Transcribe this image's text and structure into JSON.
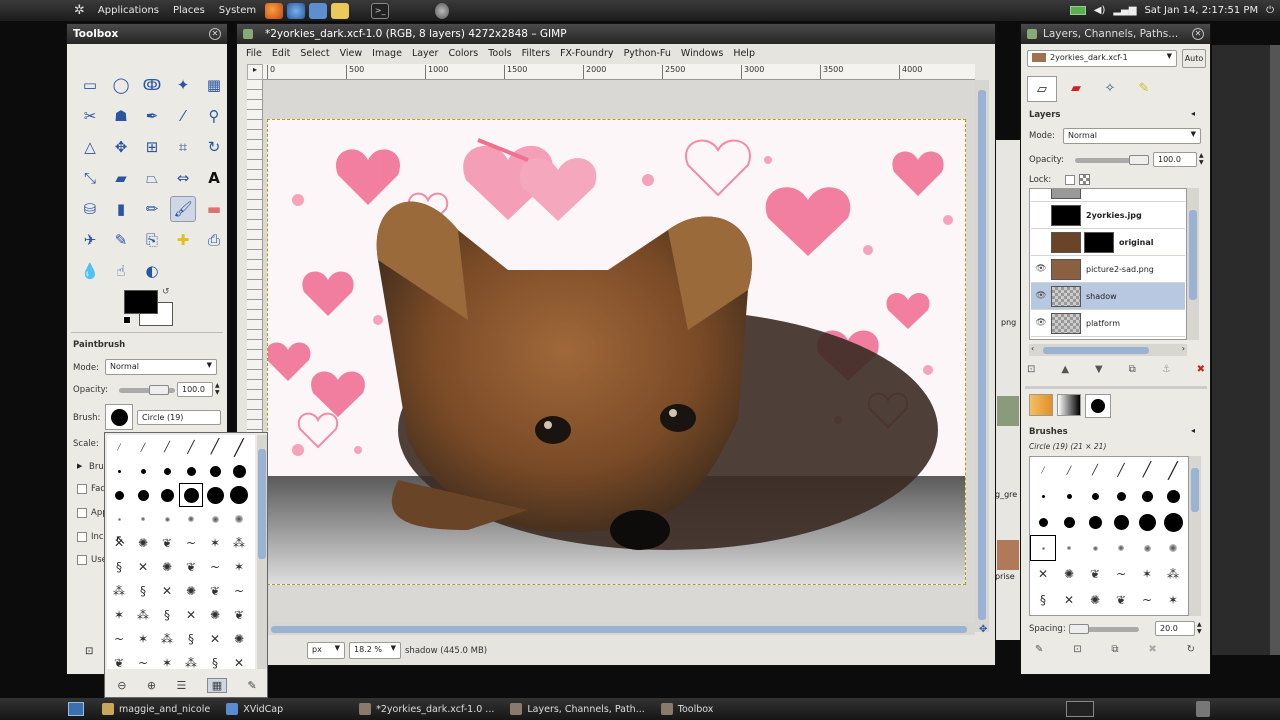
{
  "top_panel": {
    "menus": [
      "Applications",
      "Places",
      "System"
    ],
    "datetime": "Sat Jan 14,  2:17:51 PM"
  },
  "toolbox": {
    "title": "Toolbox",
    "tool_icons": [
      "rect-select-icon",
      "ellipse-select-icon",
      "free-select-icon",
      "fuzzy-select-icon",
      "color-select-icon",
      "scissors-icon",
      "foreground-select-icon",
      "paths-icon",
      "color-picker-icon",
      "zoom-icon",
      "measure-icon",
      "move-icon",
      "align-icon",
      "crop-icon",
      "rotate-icon",
      "scale-icon",
      "shear-icon",
      "perspective-icon",
      "flip-icon",
      "text-icon",
      "bucket-fill-icon",
      "blend-icon",
      "pencil-icon",
      "paintbrush-icon",
      "eraser-icon",
      "airbrush-icon",
      "ink-icon",
      "clone-icon",
      "heal-icon",
      "perspective-clone-icon",
      "blur-icon",
      "smudge-icon",
      "dodge-burn-icon"
    ],
    "selected_tool": 23,
    "options": {
      "title": "Paintbrush",
      "mode_label": "Mode:",
      "mode_value": "Normal",
      "opacity_label": "Opacity:",
      "opacity_value": "100.0",
      "brush_label": "Brush:",
      "brush_value": "Circle (19)",
      "scale_label": "Scale:",
      "brush_dynamics": "Bru",
      "cut_labels": [
        "Fad",
        "App",
        "Inc",
        "Use"
      ]
    }
  },
  "image_window": {
    "title": "*2yorkies_dark.xcf-1.0 (RGB, 8 layers) 4272x2848 – GIMP",
    "menu": [
      "File",
      "Edit",
      "Select",
      "View",
      "Image",
      "Layer",
      "Colors",
      "Tools",
      "Filters",
      "FX-Foundry",
      "Python-Fu",
      "Windows",
      "Help"
    ],
    "ruler_ticks": [
      "0",
      "500",
      "1000",
      "1500",
      "2000",
      "2500",
      "3000",
      "3500",
      "4000"
    ],
    "unit": "px",
    "zoom": "18.2 %",
    "status": "shadow (445.0 MB)"
  },
  "dock": {
    "title": "Layers, Channels, Paths...",
    "image_select": "2yorkies_dark.xcf-1",
    "auto_label": "Auto",
    "layers_tab_title": "Layers",
    "mode_label": "Mode:",
    "mode_value": "Normal",
    "opacity_label": "Opacity:",
    "opacity_value": "100.0",
    "lock_label": "Lock:",
    "layers": [
      {
        "name": "2yorkies.jpg",
        "visible": false,
        "mask": true,
        "bold": true
      },
      {
        "name": "original",
        "visible": false,
        "mask": true,
        "bold": true
      },
      {
        "name": "picture2-sad.png",
        "visible": true,
        "mask": false,
        "bold": false
      },
      {
        "name": "shadow",
        "visible": true,
        "mask": false,
        "bold": false,
        "selected": true
      },
      {
        "name": "platform",
        "visible": true,
        "mask": false,
        "bold": false
      }
    ],
    "brushes_title": "Brushes",
    "brush_info": "Circle (19) (21 × 21)",
    "spacing_label": "Spacing:",
    "spacing_value": "20.0"
  },
  "background_window_fragments": [
    "png",
    "g_gre",
    "prise"
  ],
  "taskbar": [
    {
      "label": "maggie_and_nicole",
      "icon": "folder-icon"
    },
    {
      "label": "XVidCap",
      "icon": "window-icon"
    },
    {
      "label": "*2yorkies_dark.xcf-1.0 ...",
      "icon": "gimp-icon"
    },
    {
      "label": "Layers, Channels, Path...",
      "icon": "gimp-icon"
    },
    {
      "label": "Toolbox",
      "icon": "gimp-icon"
    }
  ],
  "colors": {
    "accent": "#2a55a0",
    "selection": "#b8c8e0",
    "canvas_bg": "#dcdcdc"
  }
}
